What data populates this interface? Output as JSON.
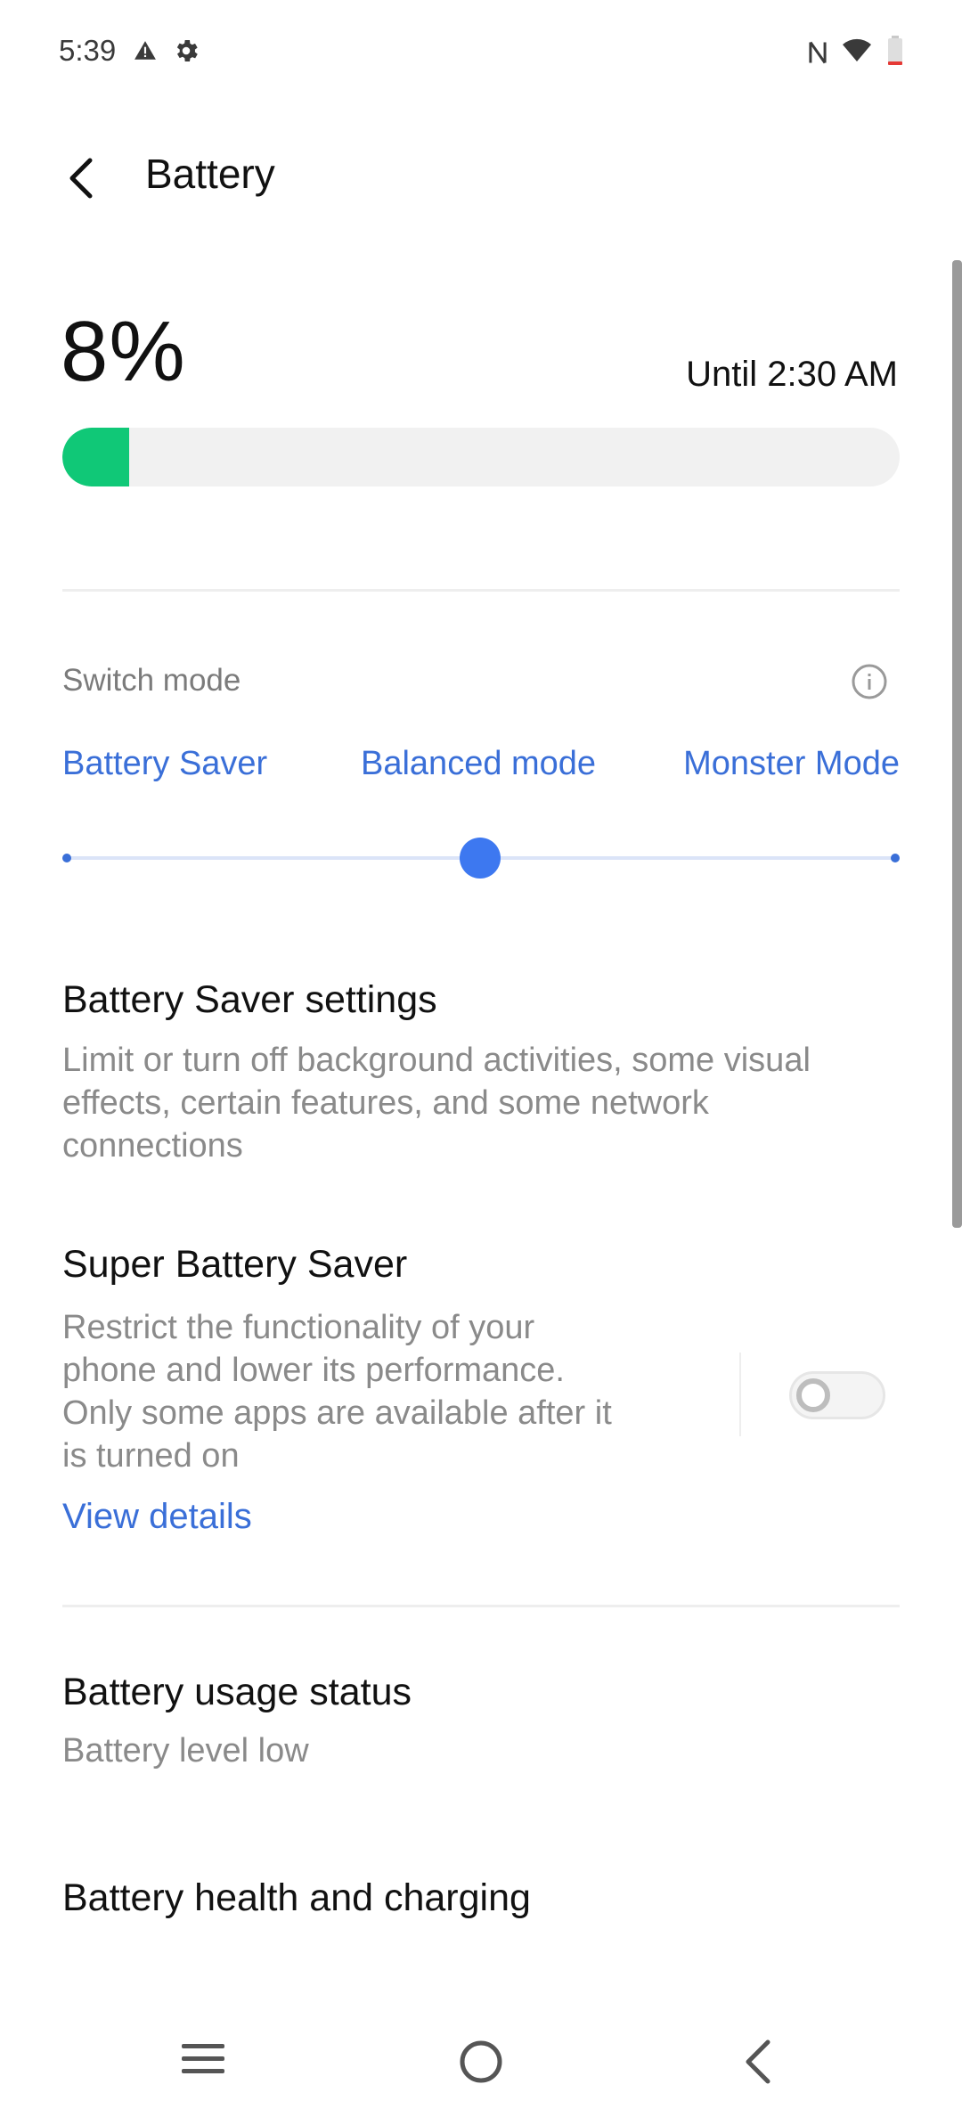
{
  "status_bar": {
    "time": "5:39",
    "icons": [
      "warning-icon",
      "gear-icon",
      "nfc-icon",
      "wifi-icon",
      "battery-low-icon"
    ]
  },
  "header": {
    "title": "Battery",
    "back_icon": "back-arrow-icon"
  },
  "battery": {
    "percent_label": "8%",
    "level_fraction": 0.08,
    "until": "Until 2:30 AM",
    "fill_color": "#10c877"
  },
  "switch_mode": {
    "label": "Switch mode",
    "info_icon": "info-icon",
    "modes": [
      "Battery Saver",
      "Balanced mode",
      "Monster Mode"
    ],
    "selected_mode": "Balanced mode",
    "accent_color": "#3a6fd8"
  },
  "battery_saver_settings": {
    "title": "Battery Saver settings",
    "desc_lines": [
      "Limit or turn off background activities, some visual",
      "effects, certain features, and some network",
      "connections"
    ]
  },
  "super_battery_saver": {
    "title": "Super Battery Saver",
    "desc_lines": [
      "Restrict the functionality of your",
      "phone and lower its performance.",
      "Only some apps are available after it",
      "is turned on"
    ],
    "link": "View details",
    "toggle_on": false
  },
  "battery_usage_status": {
    "title": "Battery usage status",
    "desc": "Battery level low"
  },
  "battery_health": {
    "title": "Battery health and charging"
  },
  "nav_bar": {
    "icons": [
      "recent-apps-icon",
      "home-icon",
      "back-icon"
    ]
  }
}
